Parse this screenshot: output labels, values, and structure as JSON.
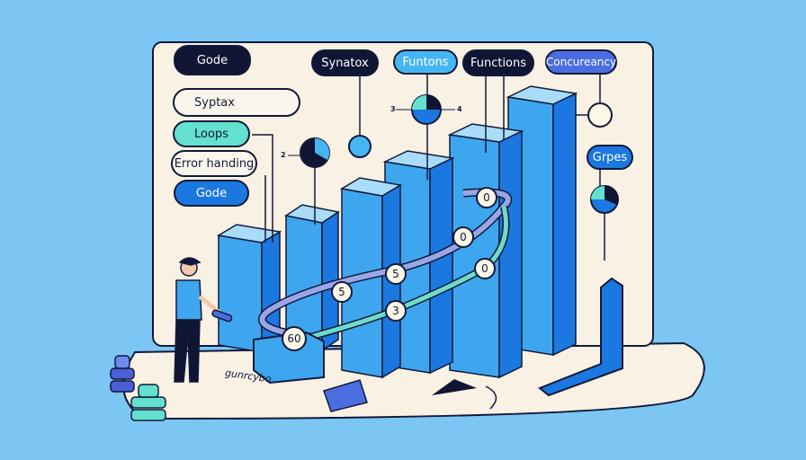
{
  "labels": {
    "code_top": "Gode",
    "syntax_top": "Synatox",
    "funtons": "Funtons",
    "functions": "Functions",
    "concurrency": "Concureancy",
    "syptax": "Syptax",
    "loops": "Loops",
    "error_handling": "Error handing",
    "code_blue": "Gode",
    "grpes": "Grpes",
    "scribble": "gunrcybo"
  },
  "path_markers": [
    "60",
    "5",
    "5",
    "0",
    "0",
    "0",
    "3"
  ],
  "pie_ticks": {
    "left": "2",
    "top_left": "3",
    "top_right": "4"
  },
  "colors": {
    "background": "#7cc6f4",
    "panel": "#f8f1e4",
    "bar": "#3ea6ef",
    "accent": "#1b78e0",
    "mint": "#63e0d0",
    "ink": "#121a3a"
  }
}
